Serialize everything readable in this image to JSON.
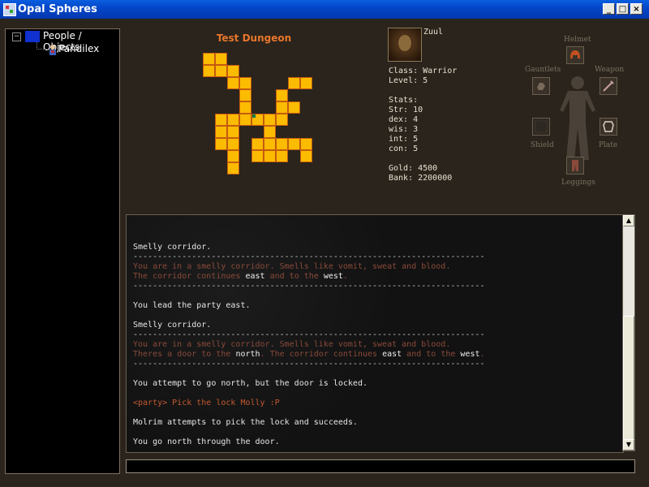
{
  "window": {
    "title": "Opal Spheres"
  },
  "tree": {
    "root_label": "People / Objects",
    "child_label": "Pandilex",
    "expander": "−"
  },
  "map": {
    "title": "Test Dungeon"
  },
  "character": {
    "name": "Zuul",
    "class_line": "Class: Warrior",
    "level_line": "Level: 5",
    "stats_header": "Stats:",
    "str_line": "Str: 10",
    "dex_line": "dex: 4",
    "wis_line": "wis: 3",
    "int_line": "int: 5",
    "con_line": "con: 5",
    "gold_line": "Gold: 4500",
    "bank_line": "Bank: 2200000"
  },
  "equipment": {
    "helmet": "Helmet",
    "gauntlets": "Gauntlets",
    "weapon": "Weapon",
    "shield": "Shield",
    "plate": "Plate",
    "leggings": "Leggings"
  },
  "log": {
    "l1": "Smelly corridor.",
    "sep": "------------------------------------------------------------------------",
    "l2": "You are in a smelly corridor. Smells like vomit, sweat and blood.",
    "l3a": "The corridor continues ",
    "l3b": "east",
    "l3c": " and to the ",
    "l3d": "west",
    "l3e": ".",
    "l4": "You lead the party east.",
    "l5": "Smelly corridor.",
    "l6": "You are in a smelly corridor. Smells like vomit, sweat and blood.",
    "l7a": "Theres a door to the ",
    "l7b": "north",
    "l7c": ". The corridor continues ",
    "l7d": "east",
    "l7e": " and to the ",
    "l7f": "west",
    "l7g": ".",
    "l8": "You attempt to go north, but the door is locked.",
    "l9": "<party> Pick the lock Molly :P",
    "l10": "Molrim attempts to pick the lock and succeeds.",
    "l11": "You go north through the door."
  },
  "command": {
    "value": ""
  }
}
